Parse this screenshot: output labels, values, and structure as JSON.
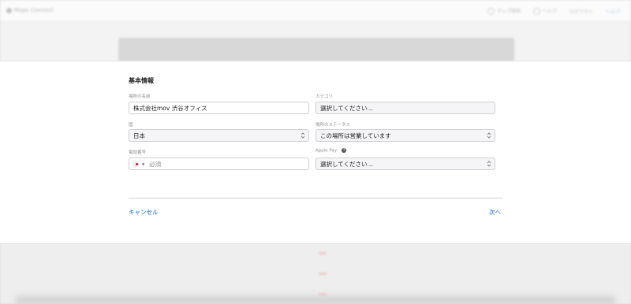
{
  "background": {
    "app_name": "Maps Connect",
    "topbar_items": [
      "マップ接続",
      "ヘルプ",
      "ログアウト"
    ],
    "link_label": "ヘルプ",
    "rows": [
      "",
      "",
      ""
    ]
  },
  "form": {
    "section_title": "基本情報",
    "place_name": {
      "label": "場所の名前",
      "value": "株式会社mov 渋谷オフィス"
    },
    "category": {
      "label": "カテゴリ",
      "value": "選択してください…"
    },
    "country": {
      "label": "国",
      "value": "日本"
    },
    "status": {
      "label": "場所のステータス",
      "value": "この場所は営業しています"
    },
    "phone": {
      "label": "電話番号",
      "placeholder": "必須",
      "flag": "jp-flag-icon"
    },
    "apple_pay": {
      "label": "Apple Pay",
      "value": "選択してください…"
    }
  },
  "actions": {
    "cancel": "キャンセル",
    "next": "次へ"
  },
  "colors": {
    "link": "#0a66d6",
    "sheet": "#ffffff",
    "backdrop": "#f3f3f3"
  }
}
